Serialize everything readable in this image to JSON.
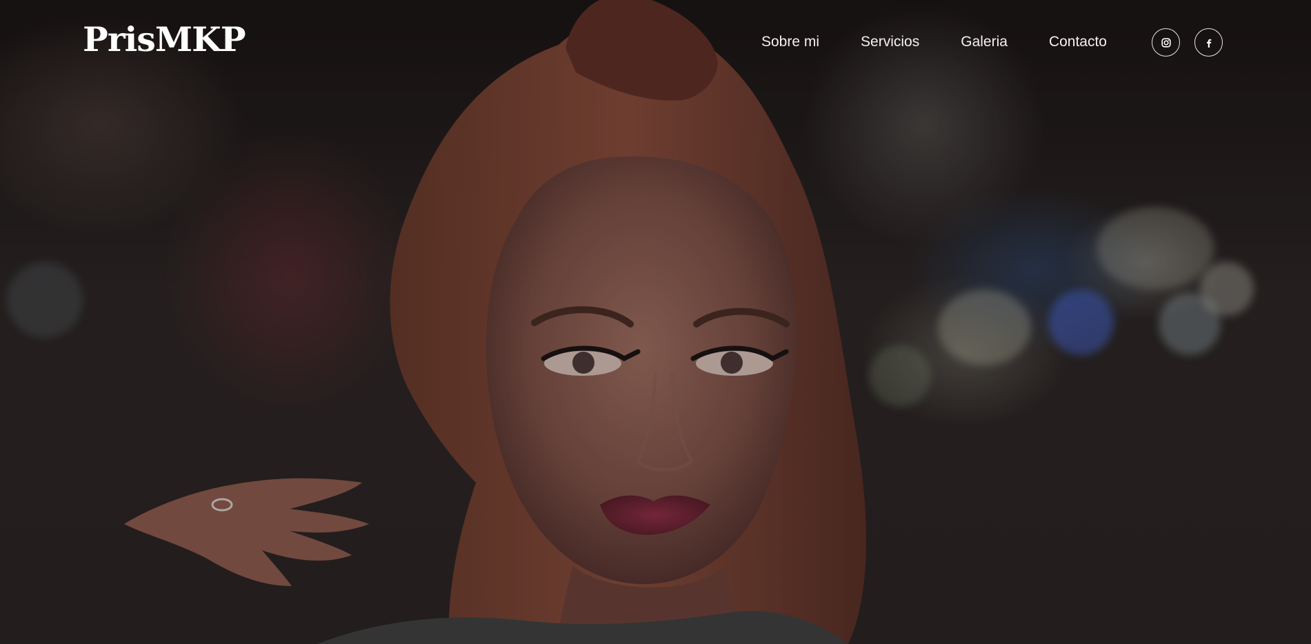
{
  "site": {
    "brand": "PrisMKP",
    "nav": [
      {
        "label": "Sobre mi"
      },
      {
        "label": "Servicios"
      },
      {
        "label": "Galeria"
      },
      {
        "label": "Contacto"
      }
    ],
    "social": [
      {
        "name": "instagram",
        "icon": "instagram-icon"
      },
      {
        "name": "facebook",
        "icon": "facebook-icon"
      }
    ]
  },
  "hero": {
    "image": "portrait-photo"
  },
  "colors": {
    "text": "#ffffff",
    "background": "#1a1312"
  }
}
